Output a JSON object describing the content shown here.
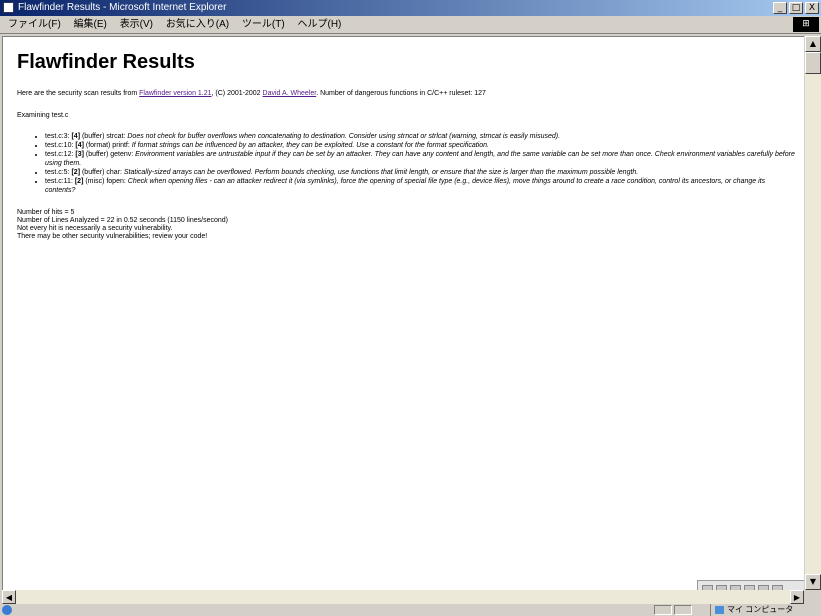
{
  "window": {
    "title": "Flawfinder Results - Microsoft Internet Explorer",
    "minimize": "_",
    "maximize": "□",
    "close": "X"
  },
  "menubar": {
    "items": [
      "ファイル(F)",
      "編集(E)",
      "表示(V)",
      "お気に入り(A)",
      "ツール(T)",
      "ヘルプ(H)"
    ]
  },
  "page": {
    "title": "Flawfinder Results",
    "intro_prefix": "Here are the security scan results from ",
    "intro_link1": "Flawfinder version 1.21",
    "intro_middle": ", (C) 2001-2002 ",
    "intro_link2": "David A. Wheeler",
    "intro_suffix": ". Number of dangerous functions in C/C++ ruleset: 127",
    "scanning": "Examining test.c",
    "hits": [
      {
        "loc": "test.c:3: ",
        "level": "[4]",
        "cat": " (buffer) strcat: ",
        "msg": "Does not check for buffer overflows when concatenating to destination. Consider using strncat or strlcat (warning, strncat is easily misused)."
      },
      {
        "loc": "test.c:10: ",
        "level": "[4]",
        "cat": " (format) printf: ",
        "msg": "If format strings can be influenced by an attacker, they can be exploited. Use a constant for the format specification."
      },
      {
        "loc": "test.c:12: ",
        "level": "[3]",
        "cat": " (buffer) getenv: ",
        "msg": "Environment variables are untrustable input if they can be set by an attacker. They can have any content and length, and the same variable can be set more than once. Check environment variables carefully before using them."
      },
      {
        "loc": "test.c:5: ",
        "level": "[2]",
        "cat": " (buffer) char: ",
        "msg": "Statically-sized arrays can be overflowed. Perform bounds checking, use functions that limit length, or ensure that the size is larger than the maximum possible length."
      },
      {
        "loc": "test.c:11: ",
        "level": "[2]",
        "cat": " (misc) fopen: ",
        "msg": "Check when opening files - can an attacker redirect it (via symlinks), force the opening of special file type (e.g., device files), move things around to create a race condition, control its ancestors, or change its contents?"
      }
    ],
    "stats": [
      "Number of hits = 5",
      "Number of Lines Analyzed = 22 in 0.52 seconds (1150 lines/second)",
      "Not every hit is necessarily a security vulnerability.",
      "There may be other security vulnerabilities; review your code!"
    ]
  },
  "statusbar": {
    "zone_label": "マイ コンピュータ"
  }
}
